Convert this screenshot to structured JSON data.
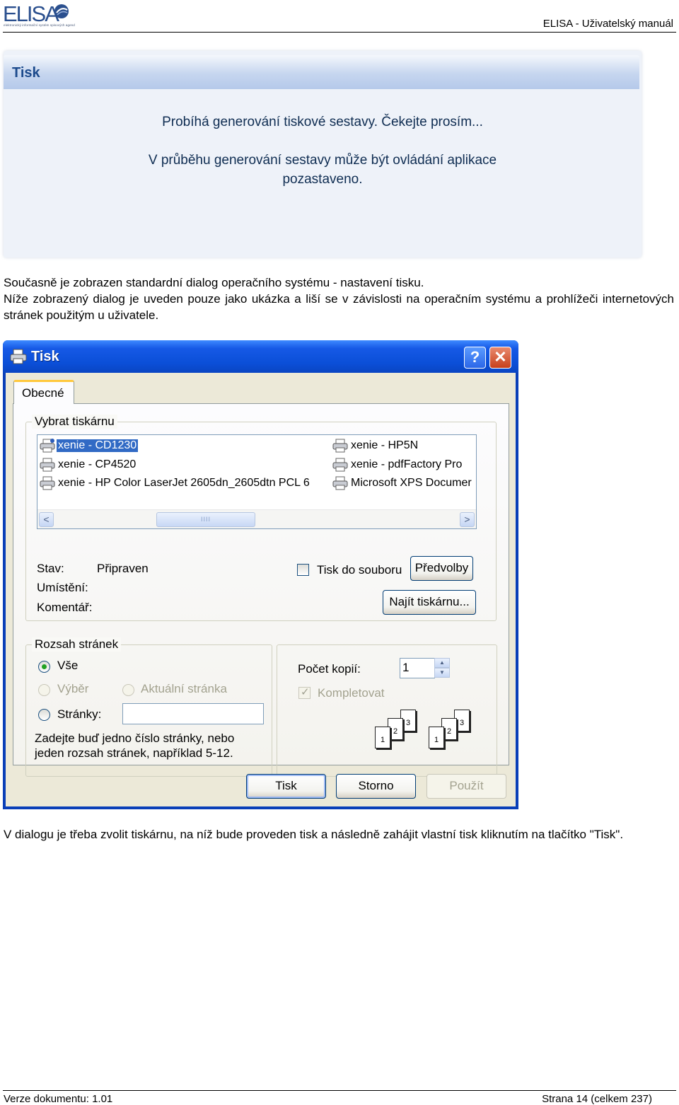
{
  "header": {
    "logo_text": "ELISA",
    "logo_tagline": "elektronický informační systém spisových agend",
    "title": "ELISA - Uživatelský manuál"
  },
  "progress_panel": {
    "title": "Tisk",
    "line1": "Probíhá generování tiskové sestavy. Čekejte prosím...",
    "line2a": "V průběhu generování sestavy může být ovládání aplikace",
    "line2b": "pozastaveno."
  },
  "paragraphs": {
    "p1": "Současně je zobrazen standardní dialog operačního systému - nastavení tisku.",
    "p2": "Níže zobrazený dialog je uveden pouze jako ukázka a liší se v závislosti na operačním systému a prohlížeči internetových stránek použitým u uživatele.",
    "p3": "V dialogu je třeba zvolit tiskárnu, na níž bude proveden tisk a následně zahájit vlastní tisk kliknutím na tlačítko \"Tisk\"."
  },
  "dialog": {
    "title": "Tisk",
    "help_glyph": "?",
    "close_glyph": "✕",
    "tab_general": "Obecné",
    "select_printer": {
      "group_title": "Vybrat tiskárnu",
      "printers": [
        {
          "name": "xenie - CD1230",
          "selected": true
        },
        {
          "name": "xenie - CP4520",
          "selected": false
        },
        {
          "name": "xenie - HP Color LaserJet 2605dn_2605dtn PCL 6",
          "selected": false
        },
        {
          "name": "xenie - HP5N",
          "selected": false
        },
        {
          "name": "xenie - pdfFactory Pro",
          "selected": false
        },
        {
          "name": "Microsoft XPS Documer",
          "selected": false
        }
      ],
      "scroll_left": "<",
      "scroll_right": ">",
      "scroll_grip": "IIII",
      "status_label": "Stav:",
      "status_value": "Připraven",
      "location_label": "Umístění:",
      "comment_label": "Komentář:",
      "print_to_file": "Tisk do souboru",
      "print_to_file_checked": false,
      "preferences_button": "Předvolby",
      "find_printer_button": "Najít tiskárnu..."
    },
    "page_range": {
      "group_title": "Rozsah stránek",
      "all": "Vše",
      "selection": "Výběr",
      "current_page": "Aktuální stránka",
      "pages": "Stránky:",
      "pages_value": "",
      "selected_option": "Vše",
      "hint_line1": "Zadejte buď jedno číslo stránky, nebo",
      "hint_line2": "jeden rozsah stránek, například 5-12."
    },
    "copies": {
      "label": "Počet kopií:",
      "value": "1",
      "spin_up": "▲",
      "spin_down": "▼",
      "collate": "Kompletovat",
      "collate_checked": true,
      "page_numbers": [
        "1",
        "2",
        "3"
      ]
    },
    "buttons": {
      "print": "Tisk",
      "cancel": "Storno",
      "apply": "Použít"
    }
  },
  "footer": {
    "version": "Verze dokumentu: 1.01",
    "page": "Strana 14 (celkem 237)"
  }
}
